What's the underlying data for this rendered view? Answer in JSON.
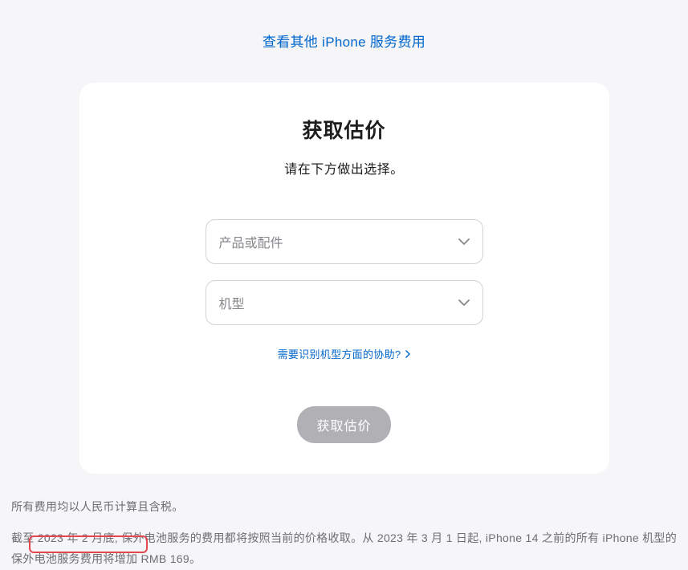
{
  "topLink": {
    "text": "查看其他 iPhone 服务费用"
  },
  "card": {
    "title": "获取估价",
    "subtitle": "请在下方做出选择。",
    "select1": {
      "placeholder": "产品或配件"
    },
    "select2": {
      "placeholder": "机型"
    },
    "helpLink": "需要识别机型方面的协助?",
    "submitButton": "获取估价"
  },
  "footer": {
    "line1": "所有费用均以人民币计算且含税。",
    "line2_part1": "截至 2023 年 2 月底, 保外电池服务的费用都将按照当前的价格收取。从 2023 年 3 月 1 日起, iPhone 14 之前的所有 iPhone 机型的保外电池服务",
    "line2_part2": "费用将增加 RMB 169。"
  }
}
